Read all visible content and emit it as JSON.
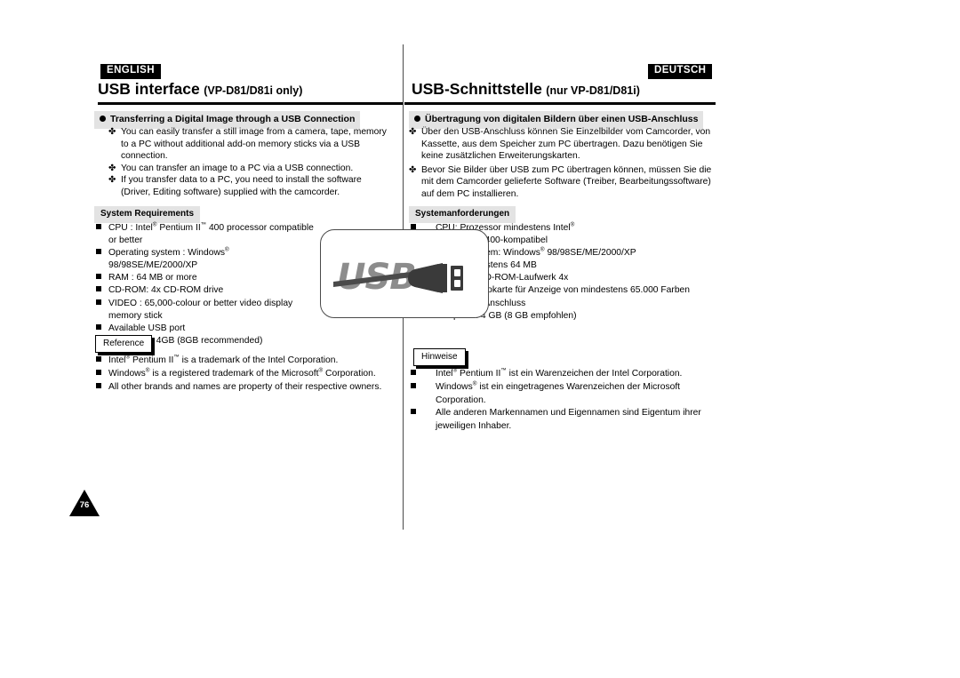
{
  "page": {
    "number": "76"
  },
  "left": {
    "language_tag": "ENGLISH",
    "title_main": "USB interface",
    "title_sub": "(VP-D81/D81i only)",
    "section_heading": "Transferring a Digital Image through a USB Connection",
    "intro_items": [
      "You can easily transfer a still image from a camera, tape, memory to a PC without additional add-on memory sticks via a USB connection.",
      "You can transfer an image to a PC via a USB connection.",
      "If you transfer data to a PC, you need to install the software (Driver, Editing software) supplied with the camcorder."
    ],
    "sysreq_label": "System Requirements",
    "sysreq_items": [
      "CPU : Intel® Pentium II™ 400 processor compatible or better",
      "Operating system : Windows® 98/98SE/ME/2000/XP",
      "RAM : 64 MB or more",
      "CD-ROM: 4x CD-ROM drive",
      "VIDEO : 65,000-colour or better video display memory stick",
      "Available USB port",
      "Hard Disc : 4GB (8GB recommended)"
    ],
    "reference_label": "Reference",
    "reference_items": [
      "Intel® Pentium II™ is a trademark of the Intel Corporation.",
      "Windows® is a registered trademark of the Microsoft® Corporation.",
      "All other brands and names are property of their respective owners."
    ]
  },
  "right": {
    "language_tag": "DEUTSCH",
    "title_main": "USB-Schnittstelle",
    "title_sub": "(nur VP-D81/D81i)",
    "section_heading": "Übertragung von digitalen Bildern über einen USB-Anschluss",
    "intro_items": [
      "Über den USB-Anschluss können Sie Einzelbilder vom Camcorder, von Kassette, aus dem Speicher zum PC übertragen. Dazu benötigen Sie keine zusätzlichen Erweiterungskarten.",
      "Bevor Sie Bilder über USB zum PC übertragen können, müssen Sie die mit dem Camcorder gelieferte Software (Treiber, Bearbeitungssoftware) auf dem PC installieren."
    ],
    "sysreq_label": "Systemanforderungen",
    "sysreq_items": [
      "CPU: Prozessor mindestens Intel® Pentium II™ 400-kompatibel",
      "Betriebssystem: Windows® 98/98SE/ME/2000/XP",
      "RAM: mindestens 64 MB",
      "CD-ROM: CD-ROM-Laufwerk 4x",
      "VIDEO: Videokarte für Anzeige von mindestens 65.000  Farben",
      "Freier USB-Anschluss",
      "Festplatte: 4 GB (8 GB empfohlen)"
    ],
    "reference_label": "Hinweise",
    "reference_items": [
      "Intel® Pentium II™ ist ein Warenzeichen der Intel Corporation.",
      "Windows® ist ein eingetragenes Warenzeichen der Microsoft Corporation.",
      "Alle anderen Markennamen und Eigennamen sind Eigentum ihrer jeweiligen Inhaber."
    ]
  },
  "logo": {
    "name": "usb-logo",
    "text": "USB",
    "text_color": "#8c8c8c",
    "plug_color": "#3a3a3a",
    "border_color": "#4a4a4a"
  },
  "bullets": {
    "diamond": "✤",
    "square": "■",
    "dot": "●"
  }
}
